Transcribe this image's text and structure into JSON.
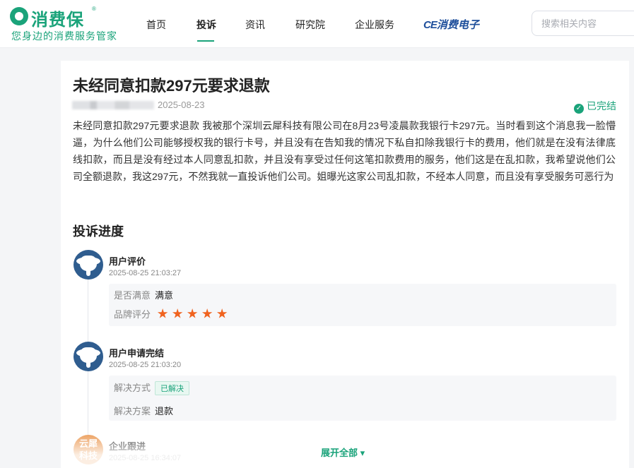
{
  "header": {
    "logo_text": "消费保",
    "logo_reg": "®",
    "slogan": "您身边的消费服务管家",
    "nav": [
      "首页",
      "投诉",
      "资讯",
      "研究院",
      "企业服务"
    ],
    "active_nav": "投诉",
    "brand_ce": "CE",
    "brand_label": "消费电子",
    "search_placeholder": "搜索相关内容"
  },
  "complaint": {
    "title": "未经同意扣款297元要求退款",
    "date": "2025-08-23",
    "status": "已完结",
    "status_icon": "check-circle-icon",
    "content": "未经同意扣款297元要求退款 我被那个深圳云犀科技有限公司在8月23号凌晨款我银行卡297元。当时看到这个消息我一脸懵逼，为什么他们公司能够授权我的银行卡号，并且没有在告知我的情况下私自扣除我银行卡的费用，他们就是在没有法律底线扣款，而且是没有经过本人同意乱扣款，并且没有享受过任何这笔扣款费用的服务，他们这是在乱扣款，我希望说他们公司全额退款，我这297元，不然我就一直投诉他们公司。姐曝光这家公司乱扣款，不经本人同意，而且没有享受服务可恶行为"
  },
  "progress": {
    "title": "投诉进度",
    "items": [
      {
        "name": "用户评价",
        "time": "2025-08-25 21:03:27",
        "avatar": "elephant-avatar",
        "rows": [
          {
            "key": "是否满意",
            "value": "满意"
          },
          {
            "key": "品牌评分",
            "rating": 5
          }
        ]
      },
      {
        "name": "用户申请完结",
        "time": "2025-08-25 21:03:20",
        "avatar": "elephant-avatar",
        "rows": [
          {
            "key": "解决方式",
            "tag": "已解决"
          },
          {
            "key": "解决方案",
            "value": "退款"
          }
        ]
      },
      {
        "name": "企业跟进",
        "time": "2025-08-25 16:34:07",
        "avatar_text": [
          "云犀",
          "科技"
        ]
      }
    ],
    "expand_label": "展开全部",
    "expand_icon": "▾"
  },
  "colors": {
    "brand_green": "#1aa37a",
    "star_orange": "#f0631f",
    "ce_blue": "#1d4e9b",
    "company_avatar": "#e88a3a"
  }
}
